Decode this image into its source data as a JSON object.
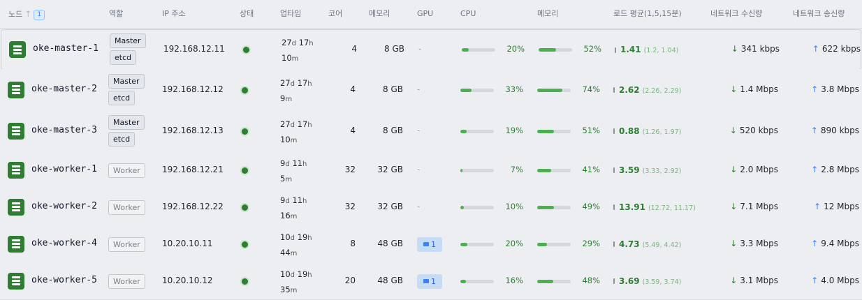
{
  "columns": {
    "node": "노드",
    "node_count": "1",
    "role": "역할",
    "ip": "IP 주소",
    "status": "상태",
    "uptime": "업타임",
    "cores": "코어",
    "memory": "메모리",
    "gpu": "GPU",
    "cpu": "CPU",
    "memory_usage": "메모리",
    "load": "로드 평균(1,5,15분)",
    "net_rx": "네트워크 수신량",
    "net_tx": "네트워크 송신량"
  },
  "colors": {
    "accent_green": "#2e7d32",
    "bar_green": "#4caf50",
    "accent_blue": "#3b82f6"
  },
  "nodes": [
    {
      "name": "oke-master-1",
      "roles": [
        "Master",
        "etcd"
      ],
      "ip": "192.168.12.11",
      "status": "running",
      "uptime": {
        "d": "27",
        "h": "17",
        "m": "10"
      },
      "cores": "4",
      "memory": "8 GB",
      "gpu": "-",
      "cpu": 0.2,
      "cpu_label": "20%",
      "mem": 0.52,
      "mem_label": "52%",
      "load_main": "1.41",
      "load_sub": "(1.2, 1.04)",
      "load_bar": 0.3,
      "rx": "341 kbps",
      "tx": "622 kbps"
    },
    {
      "name": "oke-master-2",
      "roles": [
        "Master",
        "etcd"
      ],
      "ip": "192.168.12.12",
      "status": "running",
      "uptime": {
        "d": "27",
        "h": "17",
        "m": "9"
      },
      "cores": "4",
      "memory": "8 GB",
      "gpu": "-",
      "cpu": 0.33,
      "cpu_label": "33%",
      "mem": 0.74,
      "mem_label": "74%",
      "load_main": "2.62",
      "load_sub": "(2.26, 2.29)",
      "load_bar": 0,
      "rx": "1.4 Mbps",
      "tx": "3.8 Mbps"
    },
    {
      "name": "oke-master-3",
      "roles": [
        "Master",
        "etcd"
      ],
      "ip": "192.168.12.13",
      "status": "running",
      "uptime": {
        "d": "27",
        "h": "17",
        "m": "10"
      },
      "cores": "4",
      "memory": "8 GB",
      "gpu": "-",
      "cpu": 0.19,
      "cpu_label": "19%",
      "mem": 0.51,
      "mem_label": "51%",
      "load_main": "0.88",
      "load_sub": "(1.26, 1.97)",
      "load_bar": 0,
      "rx": "520 kbps",
      "tx": "890 kbps"
    },
    {
      "name": "oke-worker-1",
      "roles": [
        "Worker"
      ],
      "ip": "192.168.12.21",
      "status": "running",
      "uptime": {
        "d": "9",
        "h": "11",
        "m": "5"
      },
      "cores": "32",
      "memory": "32 GB",
      "gpu": "-",
      "cpu": 0.07,
      "cpu_label": "7%",
      "mem": 0.41,
      "mem_label": "41%",
      "load_main": "3.59",
      "load_sub": "(3.33, 2.92)",
      "load_bar": 0,
      "rx": "2.0 Mbps",
      "tx": "2.8 Mbps"
    },
    {
      "name": "oke-worker-2",
      "roles": [
        "Worker"
      ],
      "ip": "192.168.12.22",
      "status": "running",
      "uptime": {
        "d": "9",
        "h": "11",
        "m": "16"
      },
      "cores": "32",
      "memory": "32 GB",
      "gpu": "-",
      "cpu": 0.1,
      "cpu_label": "10%",
      "mem": 0.49,
      "mem_label": "49%",
      "load_main": "13.91",
      "load_sub": "(12.72, 11.17)",
      "load_bar": 0,
      "rx": "7.1 Mbps",
      "tx": "12 Mbps"
    },
    {
      "name": "oke-worker-4",
      "roles": [
        "Worker"
      ],
      "ip": "10.20.10.11",
      "status": "running",
      "uptime": {
        "d": "10",
        "h": "19",
        "m": "44"
      },
      "cores": "8",
      "memory": "48 GB",
      "gpu": "1",
      "cpu": 0.2,
      "cpu_label": "20%",
      "mem": 0.29,
      "mem_label": "29%",
      "load_main": "4.73",
      "load_sub": "(5.49, 4.42)",
      "load_bar": 0,
      "rx": "3.3 Mbps",
      "tx": "9.4 Mbps"
    },
    {
      "name": "oke-worker-5",
      "roles": [
        "Worker"
      ],
      "ip": "10.20.10.12",
      "status": "running",
      "uptime": {
        "d": "10",
        "h": "19",
        "m": "35"
      },
      "cores": "20",
      "memory": "48 GB",
      "gpu": "1",
      "cpu": 0.16,
      "cpu_label": "16%",
      "mem": 0.48,
      "mem_label": "48%",
      "load_main": "3.69",
      "load_sub": "(3.59, 3.74)",
      "load_bar": 0,
      "rx": "3.1 Mbps",
      "tx": "4.0 Mbps"
    }
  ]
}
